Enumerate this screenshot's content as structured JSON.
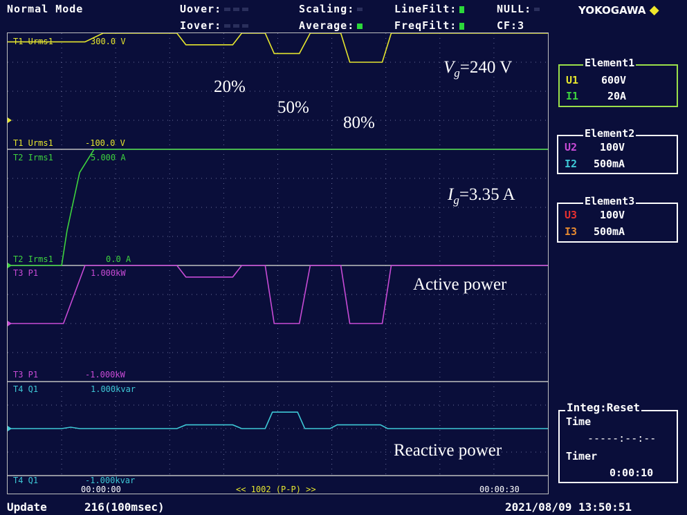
{
  "header": {
    "mode": "Normal Mode",
    "uover": "Uover:",
    "iover": "Iover:",
    "scaling": "Scaling:",
    "average": "Average:",
    "linefilt": "LineFilt:",
    "freqfilt": "FreqFilt:",
    "null_label": "NULL:",
    "cf": "CF:3",
    "brand": "YOKOGAWA",
    "brand_icon": "diamond-icon"
  },
  "traces": [
    {
      "id": "T1",
      "top_label": "T1 Urms1",
      "top_value": "300.0 V",
      "bottom_label": "T1 Urms1",
      "bottom_value": "-100.0 V",
      "color": "#e6e62e"
    },
    {
      "id": "T2",
      "top_label": "T2 Irms1",
      "top_value": "5.000 A",
      "bottom_label": "T2 Irms1",
      "bottom_value": "0.0 A",
      "color": "#3ed43e"
    },
    {
      "id": "T3",
      "top_label": "T3 P1",
      "top_value": "1.000kW",
      "bottom_label": "T3 P1",
      "bottom_value": "-1.000kW",
      "color": "#c84bd6"
    },
    {
      "id": "T4",
      "top_label": "T4 Q1",
      "top_value": "1.000kvar",
      "bottom_label": "T4 Q1",
      "bottom_value": "-1.000kvar",
      "color": "#3ec8d6"
    }
  ],
  "annotations": {
    "vg_main": "V",
    "vg_sub": "g",
    "vg_rest": "=240 V",
    "ig_main": "I",
    "ig_sub": "g",
    "ig_rest": "=3.35 A",
    "pct20": "20%",
    "pct50": "50%",
    "pct80": "80%",
    "active": "Active power",
    "reactive": "Reactive power"
  },
  "time_axis": {
    "start": "00:00:00",
    "center": "<< 1002 (P-P) >>",
    "end": "00:00:30"
  },
  "elements": [
    {
      "title": "Element1",
      "u_label": "U1",
      "u_value": "600V",
      "i_label": "I1",
      "i_value": "20A",
      "u_color": "#e6e62e",
      "i_color": "#3ed43e",
      "border": "#9be04a"
    },
    {
      "title": "Element2",
      "u_label": "U2",
      "u_value": "100V",
      "i_label": "I2",
      "i_value": "500mA",
      "u_color": "#c84bd6",
      "i_color": "#3ec8d6",
      "border": "#ffffff"
    },
    {
      "title": "Element3",
      "u_label": "U3",
      "u_value": "100V",
      "i_label": "I3",
      "i_value": "500mA",
      "u_color": "#e63030",
      "i_color": "#e68a30",
      "border": "#ffffff"
    }
  ],
  "integ": {
    "title": "Integ:Reset",
    "time_label": "Time",
    "time_value": "-----:--:--",
    "timer_label": "Timer",
    "timer_value": "0:00:10"
  },
  "footer": {
    "update": "Update",
    "count": "216(100msec)",
    "datetime": "2021/08/09  13:50:51"
  },
  "chart_data": {
    "type": "line",
    "x_unit": "s",
    "xlim": [
      0,
      30
    ],
    "series": [
      {
        "name": "T1 Urms1",
        "ylim": [
          -100,
          300
        ],
        "x": [
          0,
          4.3,
          5.3,
          9.4,
          9.9,
          12.5,
          13.0,
          14.3,
          14.8,
          16.2,
          16.8,
          18.5,
          19.0,
          20.8,
          21.3,
          30
        ],
        "y": [
          270,
          270,
          300,
          300,
          260,
          260,
          300,
          300,
          230,
          230,
          300,
          300,
          200,
          200,
          300,
          300
        ]
      },
      {
        "name": "T2 Irms1",
        "ylim": [
          0,
          5
        ],
        "x": [
          0,
          3.0,
          3.3,
          4.0,
          4.8,
          30
        ],
        "y": [
          0,
          0,
          1.5,
          4.0,
          5.0,
          5.0
        ]
      },
      {
        "name": "T3 P1",
        "ylim": [
          -1,
          1
        ],
        "x": [
          0,
          3.1,
          4.3,
          9.4,
          9.9,
          12.5,
          13.0,
          14.3,
          14.8,
          16.2,
          16.8,
          18.5,
          19.0,
          20.8,
          21.3,
          30
        ],
        "y": [
          0,
          0,
          1,
          1,
          0.8,
          0.8,
          1,
          1,
          0,
          0,
          1,
          1,
          0,
          0,
          1,
          1
        ]
      },
      {
        "name": "T4 Q1",
        "ylim": [
          -1,
          1
        ],
        "x": [
          0,
          3.0,
          3.5,
          4.0,
          9.4,
          9.9,
          12.5,
          13.0,
          14.3,
          14.7,
          16.1,
          16.5,
          17.9,
          18.3,
          20.7,
          21.1,
          30
        ],
        "y": [
          0,
          0,
          0.03,
          0,
          0,
          0.08,
          0.08,
          0,
          0,
          0.35,
          0.35,
          0,
          0,
          0.08,
          0.08,
          0,
          0
        ]
      }
    ]
  }
}
